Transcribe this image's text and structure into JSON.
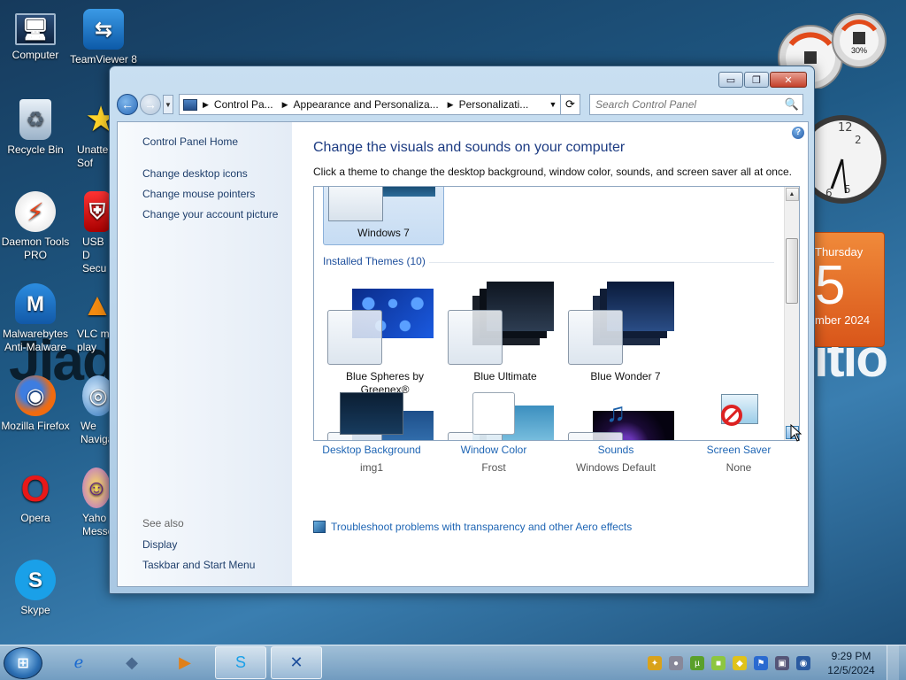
{
  "desktop": {
    "icons": [
      {
        "label": "Computer",
        "icon": "computer-icon"
      },
      {
        "label": "TeamViewer 8",
        "icon": "teamviewer-icon"
      },
      {
        "label": "Recycle Bin",
        "icon": "recycle-bin-icon"
      },
      {
        "label": "Unatte Sof",
        "icon": "star-icon"
      },
      {
        "label": "Daemon Tools PRO",
        "icon": "daemon-tools-icon"
      },
      {
        "label": "USB D Secu",
        "icon": "usb-icon"
      },
      {
        "label": "Malwarebytes Anti-Malware",
        "icon": "malwarebytes-icon"
      },
      {
        "label": "VLC m play",
        "icon": "vlc-icon"
      },
      {
        "label": "Mozilla Firefox",
        "icon": "firefox-icon"
      },
      {
        "label": "We Naviga",
        "icon": "globe-icon"
      },
      {
        "label": "Opera",
        "icon": "opera-icon"
      },
      {
        "label": "Yaho Messe",
        "icon": "yahoo-messenger-icon"
      },
      {
        "label": "Skype",
        "icon": "skype-icon"
      }
    ],
    "gadgets": {
      "meter_percent_label": "30%",
      "calendar_day": "Thursday",
      "calendar_date": "5",
      "calendar_month": "mber 2024"
    }
  },
  "window": {
    "controls": {
      "minimize": "▭",
      "maximize": "❐",
      "close": "✕"
    },
    "address": {
      "crumbs": [
        "Control Pa...",
        "Appearance and Personaliza...",
        "Personalizati..."
      ]
    },
    "search": {
      "placeholder": "Search Control Panel"
    },
    "left_pane": {
      "home": "Control Panel Home",
      "links": [
        "Change desktop icons",
        "Change mouse pointers",
        "Change your account picture"
      ],
      "see_also_label": "See also",
      "see_also": [
        "Display",
        "Taskbar and Start Menu"
      ]
    },
    "main": {
      "title": "Change the visuals and sounds on your computer",
      "description": "Click a theme to change the desktop background, window color, sounds, and screen saver all at once.",
      "selected_theme": "Windows 7",
      "installed_header": "Installed Themes (10)",
      "themes": [
        "Blue Spheres by Greenex®",
        "Blue Ultimate",
        "Blue Wonder 7"
      ],
      "bottom": [
        {
          "link": "Desktop Background",
          "value": "img1"
        },
        {
          "link": "Window Color",
          "value": "Frost"
        },
        {
          "link": "Sounds",
          "value": "Windows Default"
        },
        {
          "link": "Screen Saver",
          "value": "None"
        }
      ],
      "troubleshoot": "Troubleshoot problems with transparency and other Aero effects"
    }
  },
  "taskbar": {
    "start_glyph": "⊞",
    "time": "9:29 PM",
    "date": "12/5/2024"
  },
  "wallpaper": {
    "text_left": "Jiad",
    "text_right": "itio"
  },
  "colors": {
    "link": "#1e65b4",
    "title": "#1c3b82",
    "calendar": "#e06a24"
  }
}
